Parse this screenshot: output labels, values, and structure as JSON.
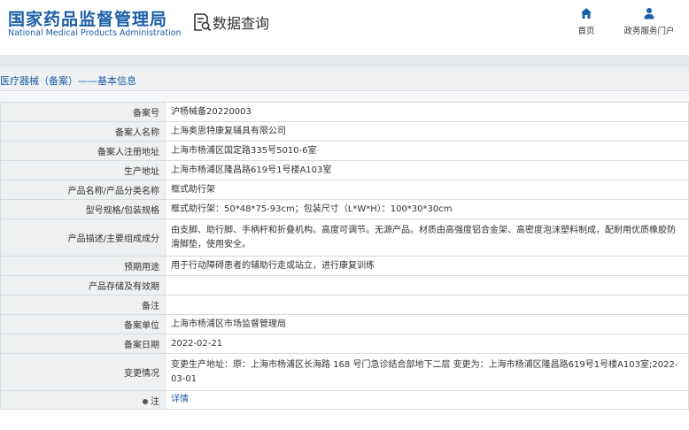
{
  "header": {
    "logo_cn": "国家药品监督管理局",
    "logo_en": "National Medical Products Administration",
    "query_title": "数据查询",
    "nav": [
      {
        "label": "首页",
        "icon": "home-icon"
      },
      {
        "label": "政务服务门户",
        "icon": "user-icon"
      }
    ]
  },
  "section_title": "医疗器械（备案）——基本信息",
  "rows": [
    {
      "label": "备案号",
      "value": "沪杨械备20220003"
    },
    {
      "label": "备案人名称",
      "value": "上海奥思特康复辅具有限公司"
    },
    {
      "label": "备案人注册地址",
      "value": "上海市杨浦区国定路335号5010-6室"
    },
    {
      "label": "生产地址",
      "value": "上海市杨浦区隆昌路619号1号楼A103室"
    },
    {
      "label": "产品名称/产品分类名称",
      "value": "框式助行架"
    },
    {
      "label": "型号规格/包装规格",
      "value": "框式助行架：50*48*75-93cm；包装尺寸（L*W*H）：100*30*30cm"
    },
    {
      "label": "产品描述/主要组成成分",
      "value": "由支脚、助行脚、手柄杆和折叠机构。高度可调节。无源产品。材质由高强度铝合金架、高密度泡沫塑料制成，配耐用优质橡胶防滑脚垫，使用安全。"
    },
    {
      "label": "预期用途",
      "value": "用于行动障碍患者的辅助行走或站立，进行康复训练"
    },
    {
      "label": "产品存储及有效期",
      "value": ""
    },
    {
      "label": "备注",
      "value": ""
    },
    {
      "label": "备案单位",
      "value": "上海市杨浦区市场监督管理局"
    },
    {
      "label": "备案日期",
      "value": "2022-02-21"
    },
    {
      "label": "变更情况",
      "value": "变更生产地址：原：上海市杨浦区长海路 168 号门急诊结合部地下二层 变更为：上海市杨浦区隆昌路619号1号楼A103室;2022-03-01"
    },
    {
      "label": "注",
      "value": "详情"
    }
  ],
  "colors": {
    "brand": "#1a5fa8",
    "label_bg": "#eef0f2",
    "border": "#d8dcdf"
  }
}
